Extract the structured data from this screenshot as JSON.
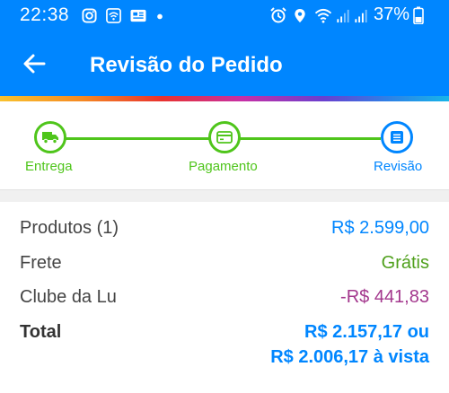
{
  "status_bar": {
    "time": "22:38",
    "battery": "37%",
    "icons": [
      "instagram-icon",
      "wifi-calling-icon",
      "news-icon",
      "dot-icon",
      "alarm-icon",
      "location-icon",
      "wifi-icon",
      "signal-icon",
      "signal-icon",
      "battery-icon"
    ]
  },
  "app_bar": {
    "title": "Revisão do Pedido",
    "back_icon": "arrow-back-icon"
  },
  "stepper": {
    "steps": [
      {
        "label": "Entrega",
        "icon": "truck-icon",
        "state": "done"
      },
      {
        "label": "Pagamento",
        "icon": "card-icon",
        "state": "done"
      },
      {
        "label": "Revisão",
        "icon": "list-icon",
        "state": "current"
      }
    ]
  },
  "summary": {
    "products_label": "Produtos (1)",
    "products_value": "R$ 2.599,00",
    "shipping_label": "Frete",
    "shipping_value": "Grátis",
    "club_label": "Clube da Lu",
    "club_value": "-R$ 441,83",
    "total_label": "Total",
    "total_value_line1": "R$ 2.157,17 ou",
    "total_value_line2": "R$ 2.006,17 à vista"
  },
  "colors": {
    "primary": "#0086ff",
    "success": "#4fc51b",
    "discount": "#a3378d"
  }
}
